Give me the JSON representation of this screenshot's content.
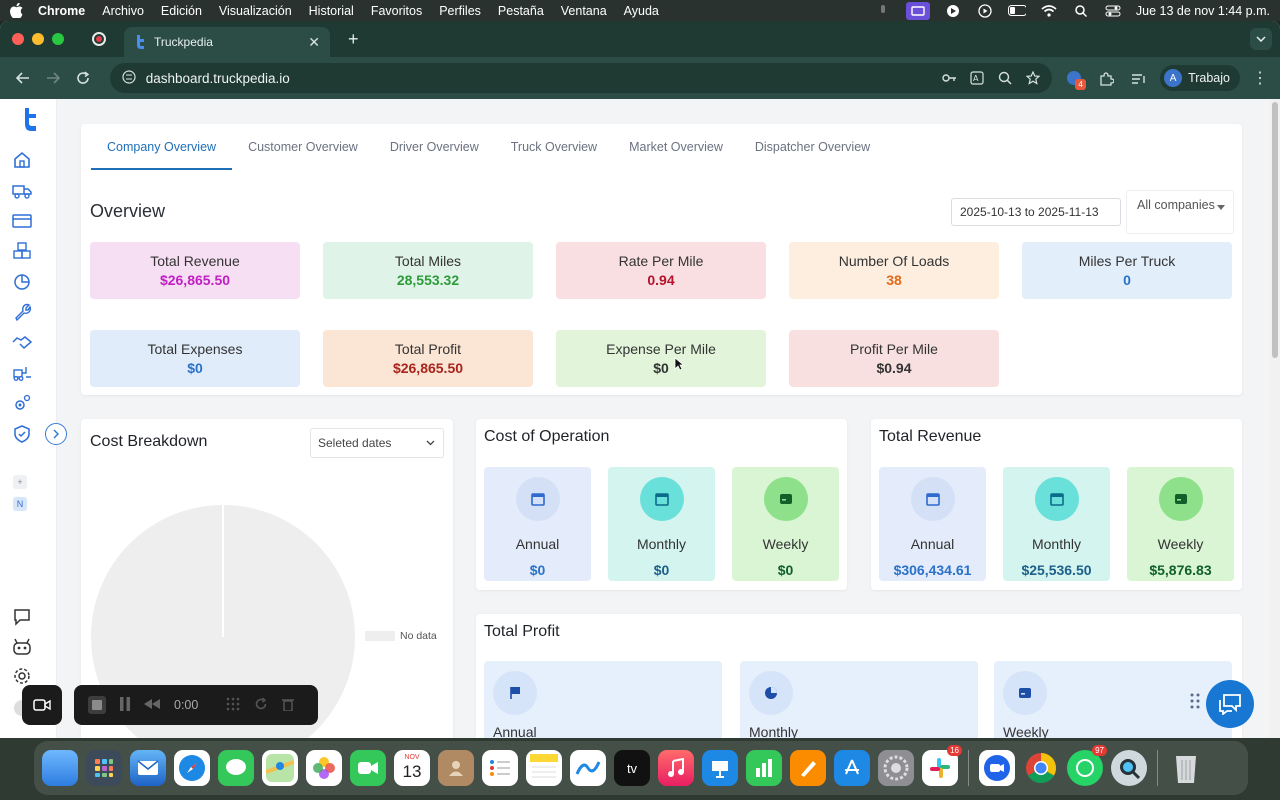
{
  "menubar": {
    "app": "Chrome",
    "items": [
      "Archivo",
      "Edición",
      "Visualización",
      "Historial",
      "Favoritos",
      "Perfiles",
      "Pestaña",
      "Ventana",
      "Ayuda"
    ],
    "datetime": "Jue 13 de nov  1:44 p.m."
  },
  "browser": {
    "tab_title": "Truckpedia",
    "url": "dashboard.truckpedia.io",
    "profile_initial": "A",
    "profile_name": "Trabajo",
    "extension_badge": "4"
  },
  "tabs": [
    "Company Overview",
    "Customer Overview",
    "Driver Overview",
    "Truck Overview",
    "Market Overview",
    "Dispatcher Overview"
  ],
  "overview": {
    "title": "Overview",
    "date_range": "2025-10-13 to 2025-11-13",
    "company_filter": "All companies",
    "stats": [
      {
        "label": "Total Revenue",
        "value": "$26,865.50",
        "color": "#c11fc4",
        "bg": "#f7dff3"
      },
      {
        "label": "Total Miles",
        "value": "28,553.32",
        "color": "#2e9b3b",
        "bg": "#dff3e8"
      },
      {
        "label": "Rate Per Mile",
        "value": "0.94",
        "color": "#b3132b",
        "bg": "#f9dfe2"
      },
      {
        "label": "Number Of Loads",
        "value": "38",
        "color": "#e26a1a",
        "bg": "#fdeee0"
      },
      {
        "label": "Miles Per Truck",
        "value": "0",
        "color": "#2a72c9",
        "bg": "#e3eefb"
      },
      {
        "label": "Total Expenses",
        "value": "$0",
        "color": "#2a72c9",
        "bg": "#e0ecfa"
      },
      {
        "label": "Total Profit",
        "value": "$26,865.50",
        "color": "#a8241c",
        "bg": "#fbe5d5"
      },
      {
        "label": "Expense Per Mile",
        "value": "$0",
        "color": "#333333",
        "bg": "#e2f5da"
      },
      {
        "label": "Profit Per Mile",
        "value": "$0.94",
        "color": "#333333",
        "bg": "#f9e0e0"
      }
    ]
  },
  "cost_breakdown": {
    "title": "Cost Breakdown",
    "date_filter": "Seleted dates",
    "legend": "No data"
  },
  "cost_of_operation": {
    "title": "Cost of Operation",
    "tiles": [
      {
        "label": "Annual",
        "value": "$0"
      },
      {
        "label": "Monthly",
        "value": "$0"
      },
      {
        "label": "Weekly",
        "value": "$0"
      }
    ]
  },
  "total_revenue": {
    "title": "Total Revenue",
    "tiles": [
      {
        "label": "Annual",
        "value": "$306,434.61"
      },
      {
        "label": "Monthly",
        "value": "$25,536.50"
      },
      {
        "label": "Weekly",
        "value": "$5,876.83"
      }
    ]
  },
  "total_profit": {
    "title": "Total Profit",
    "tiles": [
      {
        "label": "Annual"
      },
      {
        "label": "Monthly"
      },
      {
        "label": "Weekly"
      }
    ]
  },
  "recorder": {
    "time": "0:00"
  },
  "sidebar_badges": [
    "+",
    "N"
  ],
  "dock": {
    "calendar_month": "NOV",
    "calendar_day": "13",
    "tv_label": "tv",
    "slack_badge": "16",
    "whatsapp_badge": "97"
  }
}
